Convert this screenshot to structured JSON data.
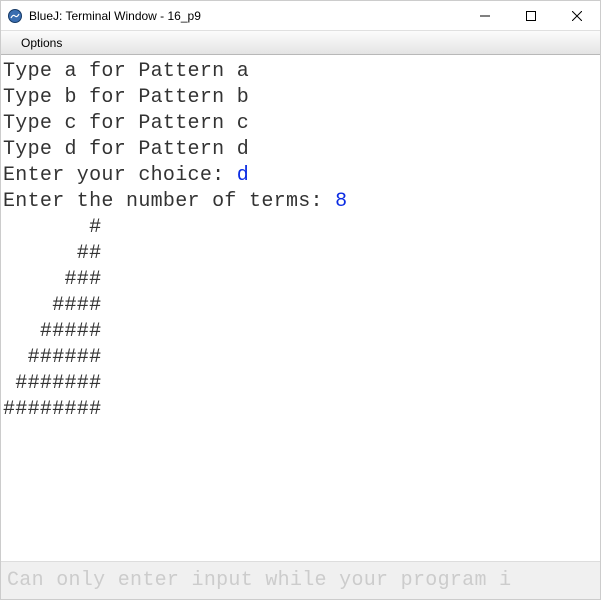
{
  "window": {
    "title": "BlueJ: Terminal Window - 16_p9"
  },
  "menu": {
    "options": "Options"
  },
  "terminal": {
    "lines": [
      {
        "text": "Type a for Pattern a",
        "input": null
      },
      {
        "text": "Type b for Pattern b",
        "input": null
      },
      {
        "text": "Type c for Pattern c",
        "input": null
      },
      {
        "text": "Type d for Pattern d",
        "input": null
      },
      {
        "text": "Enter your choice: ",
        "input": "d"
      },
      {
        "text": "Enter the number of terms: ",
        "input": "8"
      },
      {
        "text": "       #",
        "input": null
      },
      {
        "text": "      ##",
        "input": null
      },
      {
        "text": "     ###",
        "input": null
      },
      {
        "text": "    ####",
        "input": null
      },
      {
        "text": "   #####",
        "input": null
      },
      {
        "text": "  ######",
        "input": null
      },
      {
        "text": " #######",
        "input": null
      },
      {
        "text": "########",
        "input": null
      }
    ]
  },
  "footer": {
    "placeholder": "Can only enter input while your program i"
  }
}
